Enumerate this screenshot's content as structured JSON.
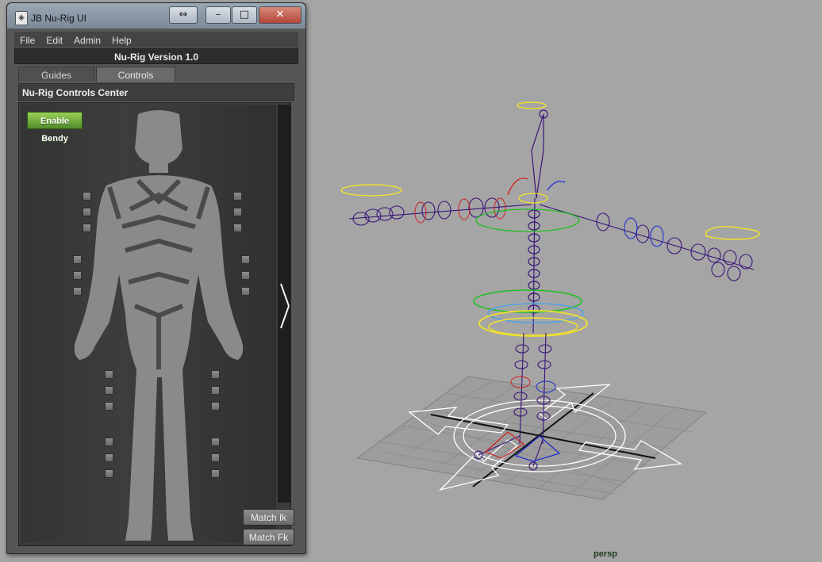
{
  "window": {
    "title": "JB Nu-Rig UI",
    "resize_glyph": "⇔",
    "minimize_glyph": "–",
    "maximize_glyph": "□",
    "close_glyph": "✕",
    "app_icon_glyph": "◈"
  },
  "menu": {
    "items": [
      "File",
      "Edit",
      "Admin",
      "Help"
    ]
  },
  "header": {
    "version": "Nu-Rig  Version 1.0"
  },
  "tabs": [
    {
      "label": "Guides",
      "active": false
    },
    {
      "label": "Controls",
      "active": true
    }
  ],
  "section": {
    "title": "Nu-Rig Controls Center"
  },
  "controls": {
    "enable_bendy": "Enable Bendy",
    "match_ik": "Match Ik",
    "match_fk": "Match Fk",
    "next_arrow": "chevron-right-icon"
  },
  "viewport": {
    "camera_label": "persp"
  },
  "colors": {
    "accent_green": "#6cab3a",
    "viewport_bg": "#a5a5a5",
    "panel_bg": "#3c3c3c",
    "joint_purple": "#4b1a8c"
  }
}
